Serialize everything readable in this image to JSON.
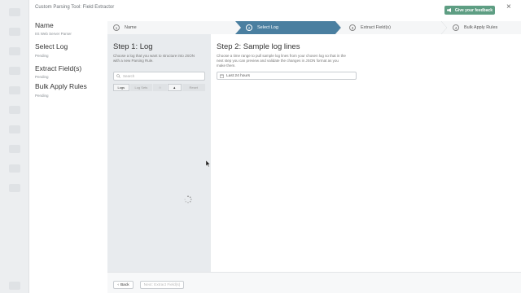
{
  "window": {
    "title": "Custom Parsing Tool: Field Extractor",
    "feedback_label": "Give your feedback",
    "close_glyph": "×",
    "accent_color": "#5e9e83",
    "step_active_color": "#4a7fa0"
  },
  "summary": {
    "name_heading": "Name",
    "name_value": "IIS Web Server Parser",
    "sections": [
      {
        "title": "Select Log",
        "status": "Pending"
      },
      {
        "title": "Extract Field(s)",
        "status": "Pending"
      },
      {
        "title": "Bulk Apply Rules",
        "status": "Pending"
      }
    ]
  },
  "steps": [
    {
      "num": "1",
      "label": "Name"
    },
    {
      "num": "2",
      "label": "Select Log"
    },
    {
      "num": "3",
      "label": "Extract Field(s)"
    },
    {
      "num": "4",
      "label": "Bulk Apply Rules"
    }
  ],
  "step1": {
    "heading": "Step 1: Log",
    "desc_lines": [
      "Choose a log that you want to structure into JSON",
      "with a new Parsing Rule."
    ],
    "search_placeholder": "Search",
    "tabs": [
      "Logs",
      "Log Sets",
      "☆",
      "▲",
      "Reset"
    ]
  },
  "step2": {
    "heading": "Step 2: Sample log lines",
    "desc_lines": [
      "Choose a time range to pull sample log lines from your chosen log so that in the",
      "next step you can preview and validate the changes in JSON format as you",
      "make them."
    ],
    "time_range_value": "Last 24 hours"
  },
  "footer": {
    "back_label": "Back",
    "next_label": "Next: Extract Field(s)"
  }
}
